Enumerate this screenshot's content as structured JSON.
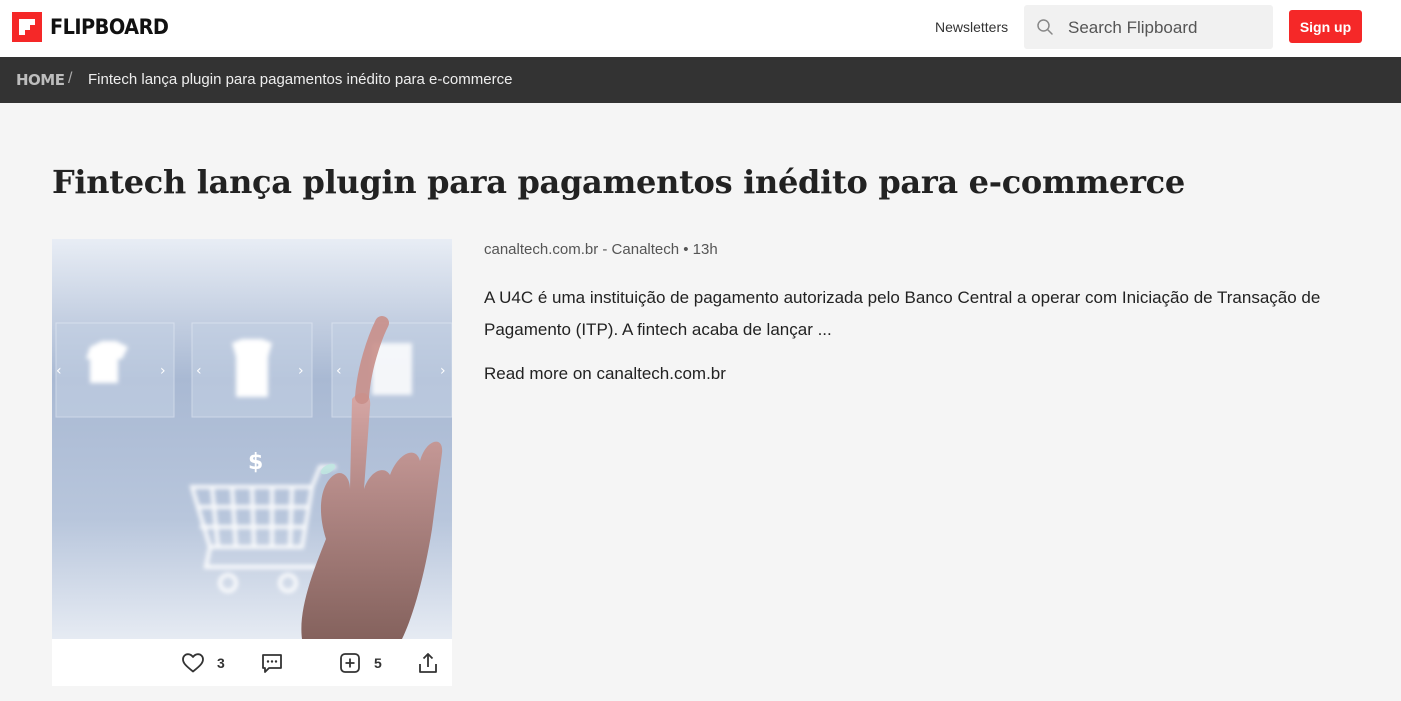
{
  "header": {
    "logo_text": "FLIPBOARD",
    "newsletters_label": "Newsletters",
    "search_placeholder": "Search Flipboard",
    "signup_label": "Sign up",
    "accent_color": "#f52828"
  },
  "breadcrumb": {
    "home": "HOME",
    "separator": "/",
    "current": "Fintech lança plugin para pagamentos inédito para e-commerce"
  },
  "article": {
    "title": "Fintech lança plugin para pagamentos inédito para e-commerce",
    "meta": "canaltech.com.br - Canaltech • 13h",
    "excerpt": "A U4C é uma instituição de pagamento autorizada pelo Banco Central a operar com Iniciação de Transação de Pagamento (ITP). A fintech acaba de lançar ...",
    "read_more": "Read more on canaltech.com.br",
    "image_icon": "hand-touching-shopping-cart-photo",
    "actions": {
      "like_icon": "heart-icon",
      "like_count": "3",
      "comment_icon": "comment-icon",
      "flip_icon": "add-icon",
      "flip_count": "5",
      "share_icon": "share-icon"
    }
  }
}
